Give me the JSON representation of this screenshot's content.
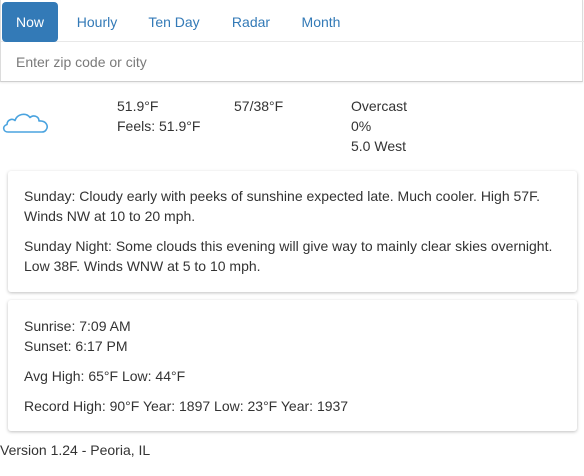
{
  "tabs": [
    {
      "label": "Now",
      "active": true
    },
    {
      "label": "Hourly",
      "active": false
    },
    {
      "label": "Ten Day",
      "active": false
    },
    {
      "label": "Radar",
      "active": false
    },
    {
      "label": "Month",
      "active": false
    }
  ],
  "search": {
    "placeholder": "Enter zip code or city"
  },
  "current": {
    "icon": "cloud-icon",
    "temp": "51.9°F",
    "feels": "Feels: 51.9°F",
    "hilo": "57/38°F",
    "condition": "Overcast",
    "precip": "0%",
    "wind": "5.0 West"
  },
  "forecast": {
    "day": "Sunday: Cloudy early with peeks of sunshine expected late. Much cooler. High 57F. Winds NW at 10 to 20 mph.",
    "night": "Sunday Night: Some clouds this evening will give way to mainly clear skies overnight. Low 38F. Winds WNW at 5 to 10 mph."
  },
  "almanac": {
    "sunrise": "Sunrise: 7:09 AM",
    "sunset": "Sunset: 6:17 PM",
    "avg": "Avg High: 65°F Low: 44°F",
    "record": "Record High: 90°F Year: 1897 Low: 23°F Year: 1937"
  },
  "footer": "Version 1.24 - Peoria, IL",
  "colors": {
    "accent": "#337ab7",
    "cloud_stroke": "#4aa3df"
  }
}
